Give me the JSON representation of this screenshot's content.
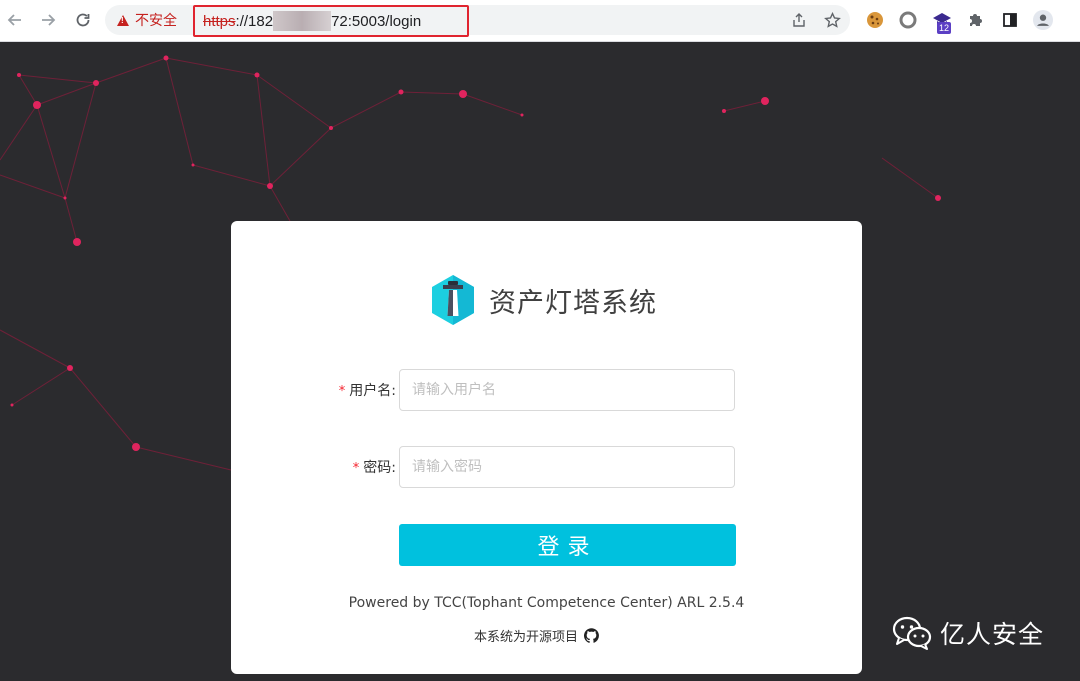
{
  "browser": {
    "security_label": "不安全",
    "url_scheme": "https",
    "url_sep": "://",
    "url_prefix": "182",
    "url_suffix": "72:5003/login",
    "extension_badge": "12"
  },
  "login": {
    "title": "资产灯塔系统",
    "username_label": "用户名:",
    "username_placeholder": "请输入用户名",
    "password_label": "密码:",
    "password_placeholder": "请输入密码",
    "required_mark": "*",
    "submit_label": "登录",
    "powered_by": "Powered by TCC(Tophant Competence Center) ARL 2.5.4",
    "open_source": "本系统为开源项目"
  },
  "watermark": {
    "text": "亿人安全"
  },
  "colors": {
    "page_background": "#2b2b2e",
    "accent": "#00c1de",
    "network_node": "#e0245e",
    "security_warning": "#c5221f"
  },
  "icons": [
    "back-arrow-icon",
    "forward-arrow-icon",
    "reload-icon",
    "warning-icon",
    "share-icon",
    "star-icon",
    "cookie-extension-icon",
    "circle-extension-icon",
    "graduation-cap-extension-icon",
    "puzzle-icon",
    "side-panel-icon",
    "profile-icon",
    "lighthouse-logo-icon",
    "github-icon",
    "wechat-icon"
  ]
}
